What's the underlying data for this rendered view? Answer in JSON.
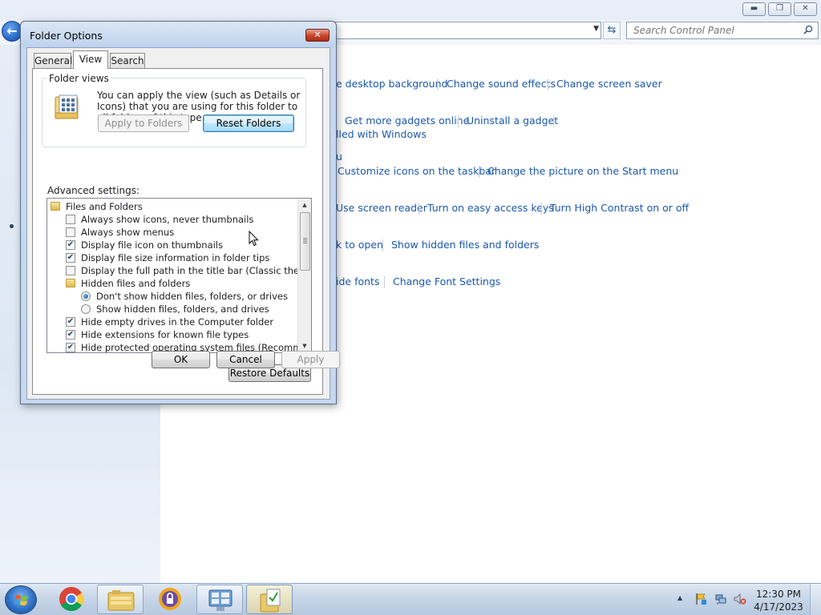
{
  "control_panel": {
    "search_placeholder": "Search Control Panel",
    "back_icon": "back-arrow-icon",
    "link_rows": [
      [
        "e desktop background",
        "Change sound effects",
        "Change screen saver"
      ],
      [
        "Get more gadgets online",
        "Uninstall a gadget"
      ],
      [
        "lled with Windows"
      ],
      [
        "u"
      ],
      [
        "Customize icons on the taskbar",
        "Change the picture on the Start menu"
      ],
      [
        "Use screen reader",
        "Turn on easy access keys",
        "Turn High Contrast on or off"
      ],
      [
        "k to open",
        "Show hidden files and folders"
      ],
      [
        "ide fonts",
        "Change Font Settings"
      ]
    ],
    "link_color": "#1b58b0"
  },
  "dialog": {
    "title": "Folder Options",
    "tabs": [
      {
        "label": "General",
        "selected": false
      },
      {
        "label": "View",
        "selected": true
      },
      {
        "label": "Search",
        "selected": false
      }
    ],
    "folder_views": {
      "label": "Folder views",
      "description": "You can apply the view (such as Details or Icons) that you are using for this folder to all folders of this type.",
      "apply_button": "Apply to Folders",
      "reset_button": "Reset Folders"
    },
    "advanced_label": "Advanced settings:",
    "tree_items": [
      {
        "type": "folder",
        "level": 0,
        "label": "Files and Folders"
      },
      {
        "type": "checkbox",
        "level": 1,
        "label": "Always show icons, never thumbnails",
        "checked": false
      },
      {
        "type": "checkbox",
        "level": 1,
        "label": "Always show menus",
        "checked": false
      },
      {
        "type": "checkbox",
        "level": 1,
        "label": "Display file icon on thumbnails",
        "checked": true
      },
      {
        "type": "checkbox",
        "level": 1,
        "label": "Display file size information in folder tips",
        "checked": true
      },
      {
        "type": "checkbox",
        "level": 1,
        "label": "Display the full path in the title bar (Classic theme only)",
        "checked": false
      },
      {
        "type": "folder",
        "level": 1,
        "label": "Hidden files and folders"
      },
      {
        "type": "radio",
        "level": 2,
        "label": "Don't show hidden files, folders, or drives",
        "checked": true
      },
      {
        "type": "radio",
        "level": 2,
        "label": "Show hidden files, folders, and drives",
        "checked": false
      },
      {
        "type": "checkbox",
        "level": 1,
        "label": "Hide empty drives in the Computer folder",
        "checked": true
      },
      {
        "type": "checkbox",
        "level": 1,
        "label": "Hide extensions for known file types",
        "checked": true
      },
      {
        "type": "checkbox",
        "level": 1,
        "label": "Hide protected operating system files (Recommended)",
        "checked": true
      }
    ],
    "restore_defaults": "Restore Defaults",
    "ok": "OK",
    "cancel": "Cancel",
    "apply": "Apply"
  },
  "taskbar": {
    "items": [
      {
        "name": "chrome",
        "icon": "chrome-icon"
      },
      {
        "name": "windows-explorer",
        "icon": "folder-library-icon"
      },
      {
        "name": "keepass",
        "icon": "keepass-lock-icon"
      },
      {
        "name": "control-panel",
        "icon": "control-panel-icon"
      },
      {
        "name": "folder-options",
        "icon": "folder-options-icon"
      }
    ],
    "clock_time": "12:30 PM",
    "clock_date": "4/17/2023"
  }
}
